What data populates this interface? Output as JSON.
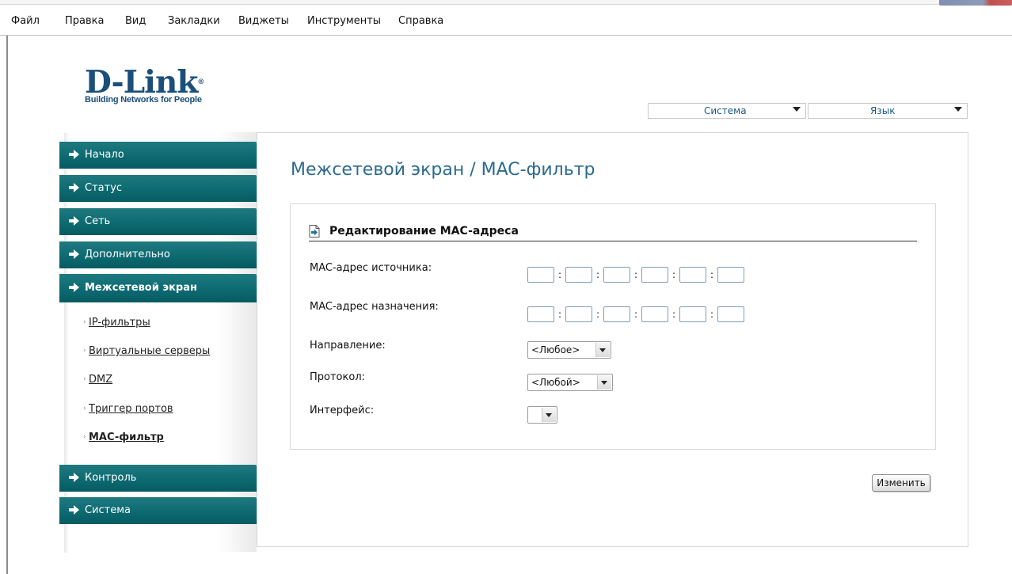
{
  "menubar": {
    "items": [
      "Файл",
      "Правка",
      "Вид",
      "Закладки",
      "Виджеты",
      "Инструменты",
      "Справка"
    ]
  },
  "logo": {
    "brand": "D-Link",
    "reg": "®",
    "tagline": "Building Networks for People"
  },
  "top_selects": {
    "system": "Система",
    "language": "Язык"
  },
  "nav": {
    "items": [
      {
        "label": "Начало",
        "active": false
      },
      {
        "label": "Статус",
        "active": false
      },
      {
        "label": "Сеть",
        "active": false
      },
      {
        "label": "Дополнительно",
        "active": false
      },
      {
        "label": "Межсетевой экран",
        "active": true
      },
      {
        "label": "Контроль",
        "active": false
      },
      {
        "label": "Система",
        "active": false
      }
    ],
    "sub_items": [
      {
        "label": "IP-фильтры",
        "active": false
      },
      {
        "label": "Виртуальные серверы",
        "active": false
      },
      {
        "label": "DMZ",
        "active": false
      },
      {
        "label": "Триггер портов",
        "active": false
      },
      {
        "label": "MAC-фильтр",
        "active": true
      }
    ]
  },
  "main": {
    "title": "Межсетевой экран / MAC-фильтр",
    "section_title": "Редактирование MAC-адреса",
    "fields": {
      "src_mac_label": "MAC-адрес источника:",
      "dst_mac_label": "MAC-адрес назначения:",
      "direction_label": "Направление:",
      "direction_value": "<Любое>",
      "protocol_label": "Протокол:",
      "protocol_value": "<Любой>",
      "interface_label": "Интерфейс:",
      "interface_value": "",
      "mac_separator": ":"
    },
    "submit_label": "Изменить"
  },
  "colors": {
    "nav_bg": "#0d6a71",
    "title": "#2b6a8e",
    "brand": "#1a4f7a"
  }
}
